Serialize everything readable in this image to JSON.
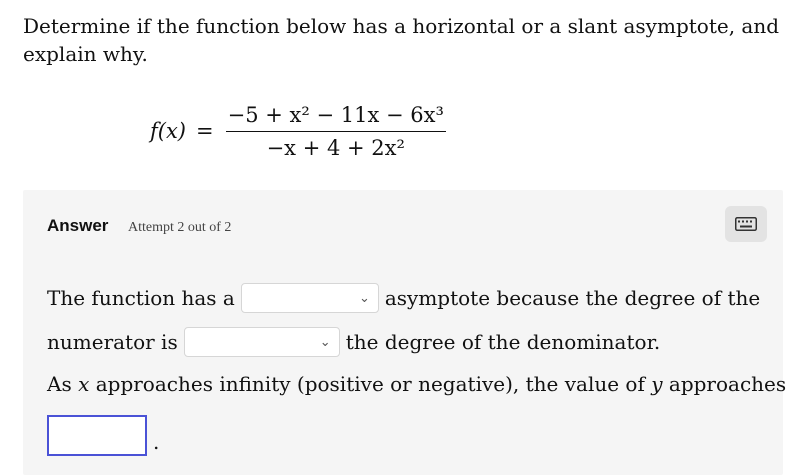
{
  "question": {
    "text": "Determine if the function below has a horizontal or a slant asymptote, and explain why."
  },
  "formula": {
    "lhs": "f(x)",
    "equals": "=",
    "numerator": "−5 + x² − 11x − 6x³",
    "denominator": "−x + 4 + 2x²"
  },
  "answer": {
    "label": "Answer",
    "attempt": "Attempt 2 out of 2",
    "keyboard_icon": "keyboard-icon",
    "line1_prefix": "The function has a",
    "line1_suffix": "asymptote because the degree of the",
    "line2_prefix": "numerator is",
    "line2_suffix": "the degree of the denominator.",
    "line3_prefix": "As",
    "line3_var1": "x",
    "line3_mid": "approaches infinity (positive or negative), the value of",
    "line3_var2": "y",
    "line3_suffix": "approaches",
    "select1_value": "",
    "select2_value": "",
    "input_value": "",
    "period": "."
  },
  "colors": {
    "panel_bg": "#f5f5f5",
    "input_border": "#4a52d6"
  }
}
